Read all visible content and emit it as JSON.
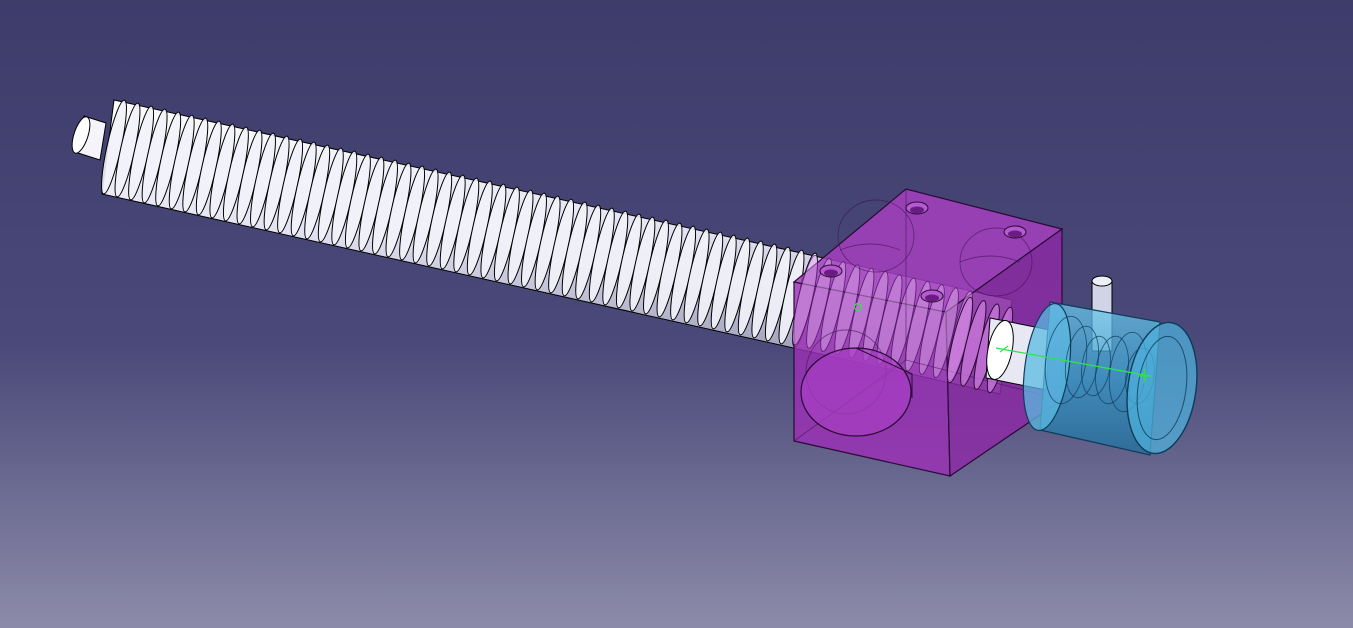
{
  "viewport": {
    "background_top": "#3d3c6b",
    "background_mid": "#4a4979",
    "background_bottom": "#8c8ba9"
  },
  "model": {
    "screw_color": "#e0e0ee",
    "screw_edge": "#000000",
    "block_color": "#9b2fb5",
    "block_edge": "#2a0a35",
    "housing_color": "#3a9fd0",
    "housing_edge": "#0d3c5a",
    "pin_color": "#d0d4e6",
    "axis_color": "#2fe34a"
  }
}
